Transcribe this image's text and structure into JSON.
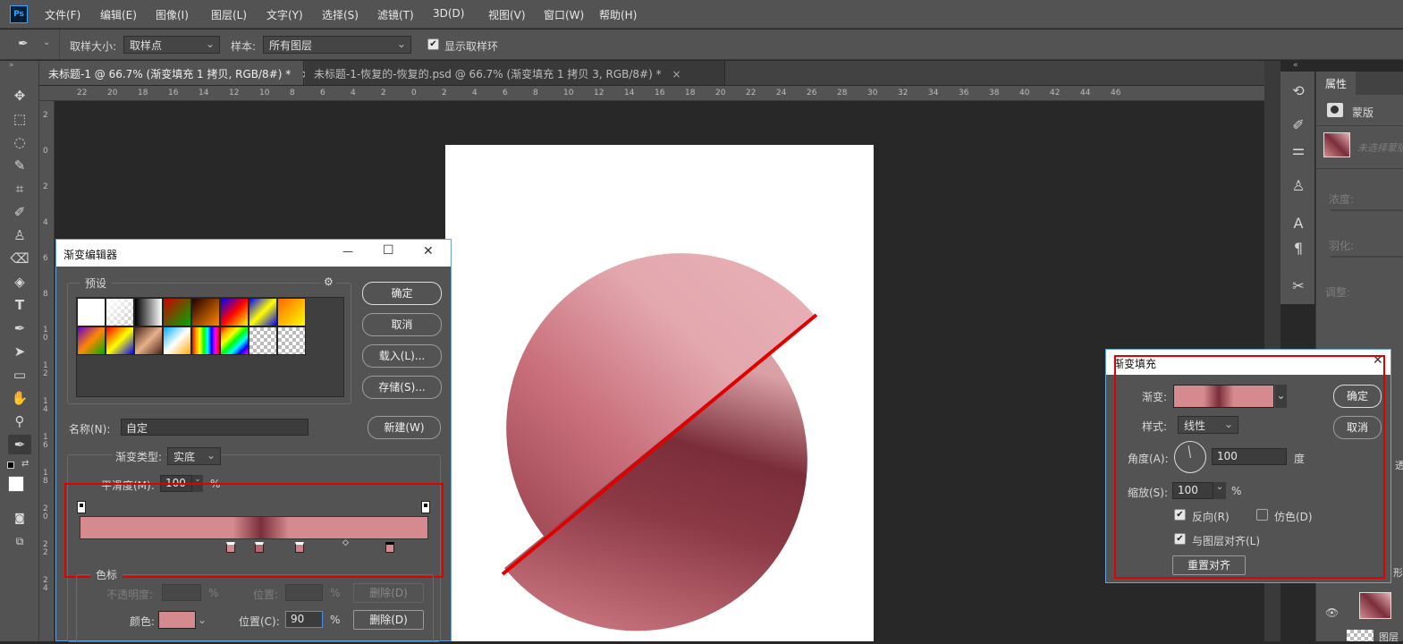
{
  "app": {
    "logo": "Ps"
  },
  "menu": [
    "文件(F)",
    "编辑(E)",
    "图像(I)",
    "图层(L)",
    "文字(Y)",
    "选择(S)",
    "滤镜(T)",
    "3D(D)",
    "视图(V)",
    "窗口(W)",
    "帮助(H)"
  ],
  "options": {
    "sample_size_label": "取样大小:",
    "sample_size_value": "取样点",
    "sample_label": "样本:",
    "sample_value": "所有图层",
    "show_ring_label": "显示取样环",
    "show_ring_checked": true
  },
  "tabs": [
    {
      "label": "未标题-1 @ 66.7% (渐变填充 1 拷贝, RGB/8#) *",
      "active": true
    },
    {
      "label": "未标题-1-恢复的-恢复的.psd @ 66.7% (渐变填充 1 拷贝 3, RGB/8#) *",
      "active": false
    }
  ],
  "tab_close_glyph": "×",
  "ruler_h_ticks": [
    "22",
    "20",
    "18",
    "16",
    "14",
    "12",
    "10",
    "8",
    "6",
    "4",
    "2",
    "0",
    "2",
    "4",
    "6",
    "8",
    "10",
    "12",
    "14",
    "16",
    "18",
    "20",
    "22",
    "24",
    "26",
    "28",
    "30",
    "32",
    "34",
    "36",
    "38",
    "40",
    "42",
    "44",
    "46"
  ],
  "ruler_v_ticks": [
    "2",
    "0",
    "2",
    "4",
    "6",
    "8",
    "1 0",
    "1 2",
    "1 4",
    "1 6",
    "1 8",
    "2 0",
    "2 2",
    "2 4"
  ],
  "gradient_editor": {
    "title": "渐变编辑器",
    "presets_label": "预设",
    "presets": [
      "#ffffff",
      "checker-white",
      "#000000",
      "#d8232a",
      "#c06010",
      "#1c1cb0",
      "#1a1aa0",
      "#ffd200",
      "#7030a0",
      "#ff8c00",
      "#6b3b2a",
      "#1f6fd0",
      "spectrum",
      "spectrum-diag",
      "checker",
      "checker"
    ],
    "ok": "确定",
    "cancel": "取消",
    "load": "载入(L)...",
    "save": "存储(S)...",
    "name_label": "名称(N):",
    "name_value": "自定",
    "new_button": "新建(W)",
    "type_label": "渐变类型:",
    "type_value": "实底",
    "smooth_label": "平滑度(M):",
    "smooth_value": "100",
    "smooth_unit": "%",
    "stops_label": "色标",
    "opacity_label": "不透明度:",
    "location_label": "位置:",
    "delete_label": "删除(D)",
    "color_label": "颜色:",
    "location2_label": "位置(C):",
    "location2_value": "90",
    "delete2_label": "删除(D)",
    "percent": "%",
    "stop_color": "#d48a8e",
    "gradient_colors": [
      "#d48a8e",
      "#7a2e3a",
      "#d48a8e"
    ]
  },
  "gradient_fill": {
    "title": "渐变填充",
    "gradient_label": "渐变:",
    "style_label": "样式:",
    "style_value": "线性",
    "angle_label": "角度(A):",
    "angle_value": "100",
    "angle_unit": "度",
    "scale_label": "缩放(S):",
    "scale_value": "100",
    "scale_unit": "%",
    "reverse_label": "反向(R)",
    "reverse_checked": true,
    "dither_label": "仿色(D)",
    "dither_checked": false,
    "align_label": "与图层对齐(L)",
    "align_checked": true,
    "reset_label": "重置对齐",
    "ok": "确定",
    "cancel": "取消"
  },
  "properties": {
    "tab": "属性",
    "mask_label": "蒙版",
    "no_mask": "未选择蒙版",
    "density": "浓度:",
    "feather": "羽化:",
    "adjust": "调整:"
  },
  "layers_peek": {
    "text1": "透",
    "text2": "形",
    "text3": "图层"
  },
  "colors": {
    "accent_red": "#e00000",
    "pink_light": "#e8b0b6",
    "pink_mid": "#c9707c",
    "maroon": "#7a2e3a"
  },
  "dialog_window_controls": {
    "minimize": "—",
    "maximize": "☐",
    "close": "✕"
  }
}
